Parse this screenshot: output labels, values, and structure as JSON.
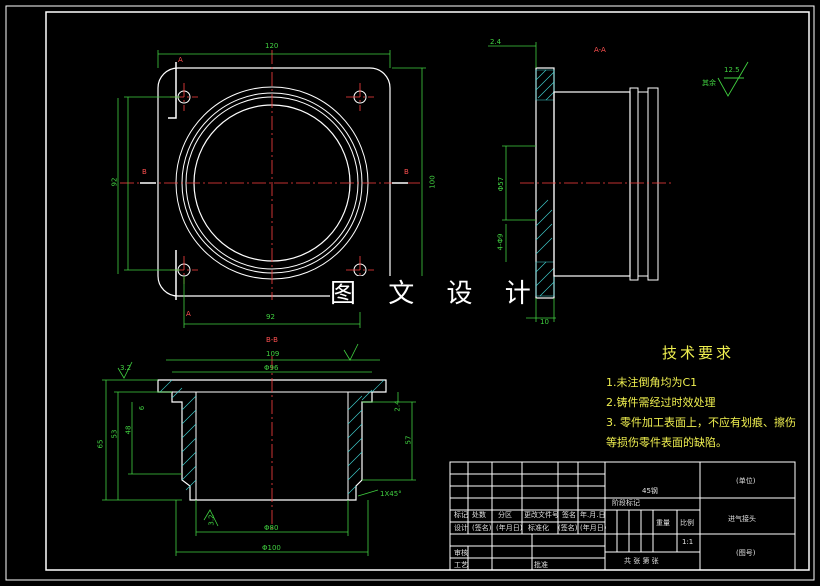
{
  "watermark": "图 文 设 计",
  "views": {
    "top": {
      "dims": [
        "120",
        "92",
        "100",
        "92"
      ],
      "section_marks": [
        "A",
        "A",
        "B",
        "B"
      ]
    },
    "side": {
      "title": "A-A",
      "dims": [
        "2.4",
        "Φ57",
        "4-Φ9",
        "10"
      ]
    },
    "bottom": {
      "title": "B-B",
      "dims": [
        "109",
        "Φ96",
        "Φ80",
        "Φ100",
        "3.2",
        "3.2",
        "6",
        "48",
        "53",
        "65",
        "2.4",
        "57",
        "1X45°"
      ]
    }
  },
  "roughness": {
    "label": "其余",
    "value": "12.5"
  },
  "tech_requirements": {
    "title": "技术要求",
    "lines": [
      "1.未注倒角均为C1",
      "2.铸件需经过时效处理",
      "3. 零件加工表面上，不应有划痕、擦伤",
      "等损伤零件表面的缺陷。"
    ]
  },
  "title_block": {
    "part_name": "进气接头",
    "material": "45钢",
    "company": "(单位)",
    "drawing_no": "(图号)",
    "scale": "1:1",
    "rows": {
      "r1": [
        "标记",
        "处数",
        "分区",
        "更改文件号",
        "签名",
        "年.月.日"
      ],
      "r2": [
        "设计",
        "(签名)",
        "(年月日)",
        "标准化",
        "(签名)",
        "(年月日)"
      ],
      "r3": [
        "审核"
      ],
      "r4": [
        "工艺",
        "批准"
      ]
    },
    "stage_labels": [
      "阶段标记",
      "重量",
      "比例"
    ],
    "sheet": "共 张 第 张"
  }
}
